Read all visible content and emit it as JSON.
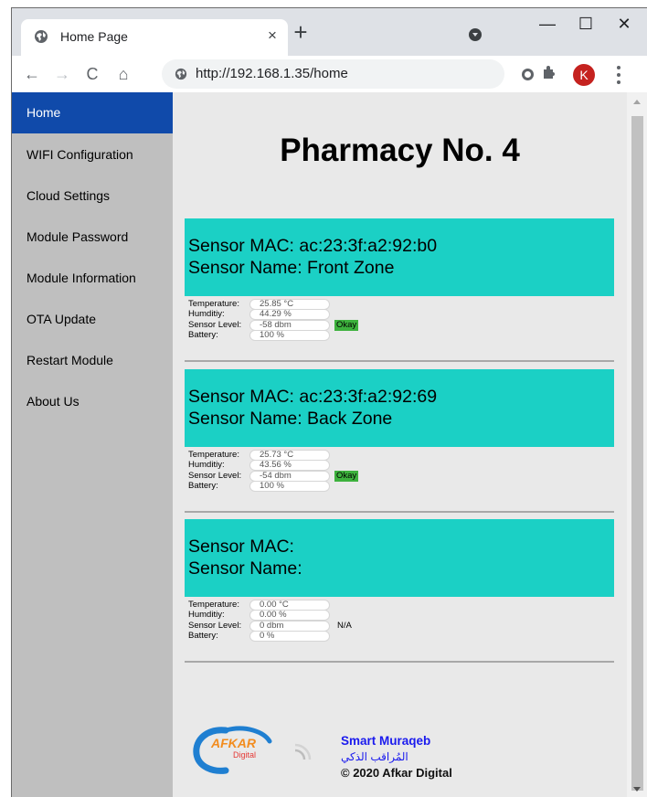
{
  "browser": {
    "tab_title": "Home Page",
    "tab_close": "×",
    "new_tab": "+",
    "url": "http://192.168.1.35/home",
    "profile_initial": "K",
    "win_min": "—",
    "win_max": "☐",
    "win_close": "✕",
    "back": "←",
    "forward": "→",
    "reload": "C",
    "home": "⌂"
  },
  "sidebar": {
    "items": [
      {
        "label": "Home"
      },
      {
        "label": "WIFI Configuration"
      },
      {
        "label": "Cloud Settings"
      },
      {
        "label": "Module Password"
      },
      {
        "label": "Module Information"
      },
      {
        "label": "OTA Update"
      },
      {
        "label": "Restart Module"
      },
      {
        "label": "About Us"
      }
    ]
  },
  "main": {
    "title": "Pharmacy No. 4",
    "labels": {
      "temperature": "Temperature:",
      "humidity": "Humditiy:",
      "sensor_level": "Sensor Level:",
      "battery": "Battery:"
    },
    "sensors": [
      {
        "mac": "Sensor MAC: ac:23:3f:a2:92:b0",
        "name": "Sensor Name: Front Zone",
        "temperature": "25.85 °C",
        "humidity": "44.29 %",
        "level": "-58 dbm",
        "battery": "100 %",
        "status": "Okay"
      },
      {
        "mac": "Sensor MAC: ac:23:3f:a2:92:69",
        "name": "Sensor Name: Back Zone",
        "temperature": "25.73 °C",
        "humidity": "43.56 %",
        "level": "-54 dbm",
        "battery": "100 %",
        "status": "Okay"
      },
      {
        "mac": "Sensor MAC:",
        "name": "Sensor Name:",
        "temperature": "0.00 °C",
        "humidity": "0.00 %",
        "level": "0 dbm",
        "battery": "0 %",
        "status": "N/A"
      }
    ]
  },
  "footer": {
    "logo_text": "AFKAR",
    "logo_sub": "Digital",
    "line1": "Smart Muraqeb",
    "line2": "المُراقب الذكي",
    "line3": "© 2020 Afkar Digital"
  },
  "colors": {
    "sidebar_active": "#104aaa",
    "sensor_header": "#1bd0c5",
    "status_ok": "#3db13d"
  }
}
